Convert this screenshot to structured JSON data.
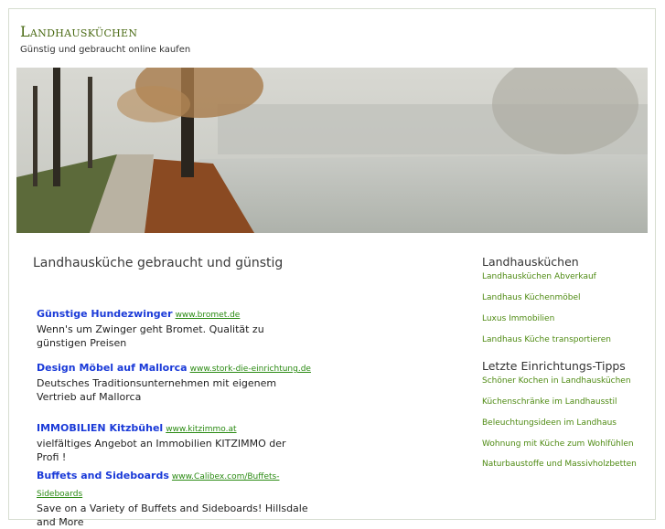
{
  "header": {
    "title": "Landhausküchen",
    "tagline": "Günstig und gebraucht online kaufen"
  },
  "main": {
    "heading": "Landhausküche gebraucht und günstig",
    "ads": [
      {
        "title": "Günstige Hundezwinger",
        "url": "www.bromet.de",
        "desc": "Wenn's um Zwinger geht Bromet. Qualität zu günstigen Preisen"
      },
      {
        "title": "Design Möbel auf Mallorca",
        "url": "www.stork-die-einrichtung.de",
        "desc": "Deutsches Traditionsunternehmen mit eigenem Vertrieb auf Mallorca"
      },
      {
        "title": "IMMOBILIEN Kitzbühel",
        "url": "www.kitzimmo.at",
        "desc": "vielfältiges Angebot an Immobilien KITZIMMO der Profi !"
      },
      {
        "title": "Buffets and Sideboards",
        "url": "www.Calibex.com/Buffets-Sideboards",
        "desc": "Save on a Variety of Buffets and Sideboards! Hillsdale and More"
      }
    ]
  },
  "sidebar": {
    "section1": {
      "heading": "Landhausküchen",
      "links": [
        "Landhausküchen Abverkauf",
        "Landhaus Küchenmöbel",
        "Luxus Immobilien",
        "Landhaus Küche transportieren"
      ]
    },
    "section2": {
      "heading": "Letzte Einrichtungs-Tipps",
      "links": [
        "Schöner Kochen in Landhausküchen",
        "Küchenschränke im Landhausstil",
        "Beleuchtungsideen im Landhaus",
        "Wohnung mit Küche zum Wohlfühlen",
        "Naturbaustoffe und Massivholzbetten"
      ]
    }
  },
  "colors": {
    "title": "#4a6a14",
    "ad_title": "#1a3ad8",
    "ad_url": "#2a8a12",
    "side_link": "#4e8a12"
  }
}
